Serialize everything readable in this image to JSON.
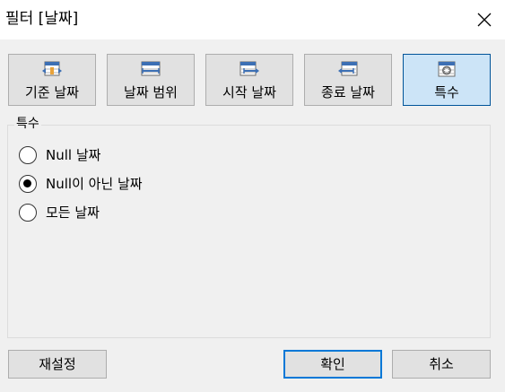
{
  "window": {
    "title": "필터 [날짜]"
  },
  "tabs": [
    {
      "label": "기준 날짜",
      "icon": "date-relative-icon",
      "active": false
    },
    {
      "label": "날짜 범위",
      "icon": "date-range-icon",
      "active": false
    },
    {
      "label": "시작 날짜",
      "icon": "start-date-icon",
      "active": false
    },
    {
      "label": "종료 날짜",
      "icon": "end-date-icon",
      "active": false
    },
    {
      "label": "특수",
      "icon": "special-date-icon",
      "active": true
    }
  ],
  "special": {
    "group_label": "특수",
    "options": [
      {
        "label": "Null 날짜",
        "checked": false
      },
      {
        "label": "Null이 아닌 날짜",
        "checked": true
      },
      {
        "label": "모든 날짜",
        "checked": false
      }
    ]
  },
  "buttons": {
    "reset": "재설정",
    "ok": "확인",
    "cancel": "취소"
  },
  "colors": {
    "active_tab_bg": "#cce4f7",
    "active_tab_border": "#005499",
    "default_button_border": "#0078d7",
    "icon_accent": "#e8a23a",
    "icon_blue": "#3c6fb4"
  }
}
